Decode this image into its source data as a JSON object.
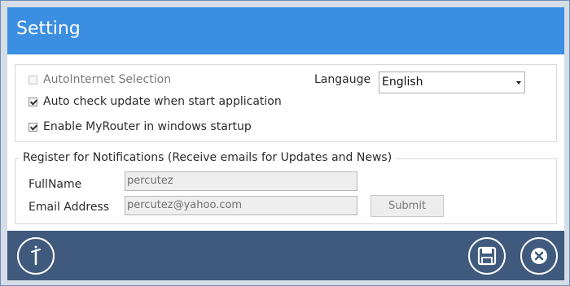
{
  "window": {
    "title": "Setting"
  },
  "general": {
    "auto_internet_label": "AutoInternet Selection",
    "auto_check_update_label": "Auto check update when start application",
    "enable_startup_label": "Enable MyRouter in windows startup",
    "language_label": "Langauge",
    "language_value": "English"
  },
  "register": {
    "title": "Register for Notifications (Receive emails for Updates and News)",
    "fullname_label": "FullName",
    "fullname_value": "percutez",
    "email_label": "Email Address",
    "email_value": "percutez@yahoo.com",
    "submit_label": "Submit"
  },
  "state": {
    "auto_internet_checked": false,
    "auto_check_update_checked": true,
    "enable_startup_checked": true
  },
  "footer": {
    "icons": [
      "info-icon",
      "save-icon",
      "close-icon"
    ]
  },
  "colors": {
    "titlebar": "#3b8ee2",
    "footer": "#3f5a7d",
    "window_border": "#6d8db8"
  }
}
